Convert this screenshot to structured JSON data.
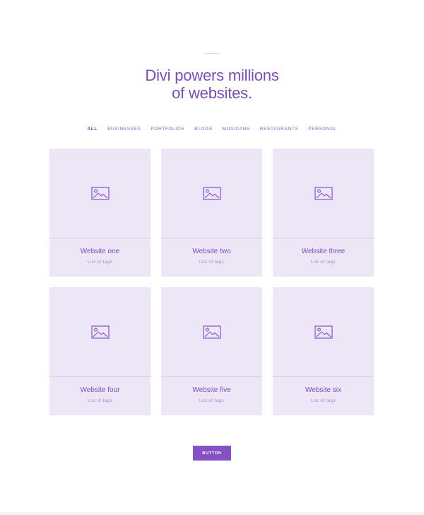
{
  "headline": {
    "line1": "Divi powers millions",
    "line2": "of websites."
  },
  "filters": [
    {
      "label": "ALL",
      "active": true
    },
    {
      "label": "BUSINESSES",
      "active": false
    },
    {
      "label": "PORTFOLIOS",
      "active": false
    },
    {
      "label": "BLOGS",
      "active": false
    },
    {
      "label": "MUSICANS",
      "active": false
    },
    {
      "label": "RESTAURANTS",
      "active": false
    },
    {
      "label": "PERSONAL",
      "active": false
    }
  ],
  "cards": [
    {
      "title": "Website one",
      "tags": "List of tags",
      "icon": "image-placeholder-icon"
    },
    {
      "title": "Website two",
      "tags": "List of tags",
      "icon": "image-placeholder-icon"
    },
    {
      "title": "Website three",
      "tags": "List of tags",
      "icon": "image-placeholder-icon"
    },
    {
      "title": "Website four",
      "tags": "List of tags",
      "icon": "image-placeholder-icon"
    },
    {
      "title": "Website five",
      "tags": "List of tags",
      "icon": "image-placeholder-icon"
    },
    {
      "title": "Website six",
      "tags": "List of tags",
      "icon": "image-placeholder-icon"
    }
  ],
  "button": {
    "label": "BUTTON"
  },
  "colors": {
    "accent": "#7a4cc0",
    "card_bg": "#ece6f6",
    "button_bg": "#8452c6"
  }
}
